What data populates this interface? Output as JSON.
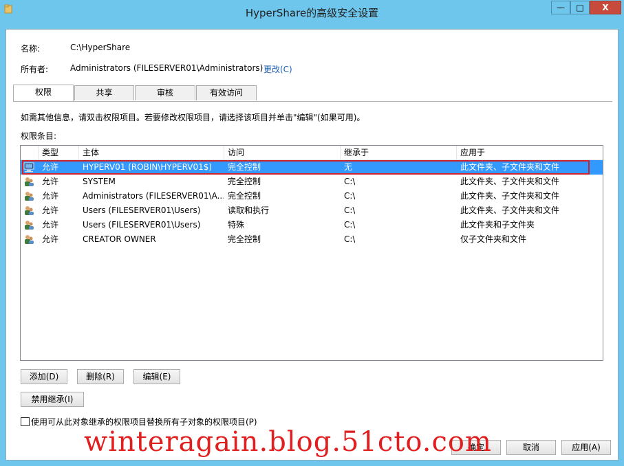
{
  "window": {
    "title": "HyperShare的高级安全设置",
    "min": "—",
    "max": "□",
    "close": "X"
  },
  "info": {
    "name_label": "名称:",
    "name_value": "C:\\HyperShare",
    "owner_label": "所有者:",
    "owner_value": "Administrators (FILESERVER01\\Administrators)",
    "owner_change": "更改(C)"
  },
  "tabs": [
    {
      "label": "权限",
      "active": true
    },
    {
      "label": "共享",
      "active": false
    },
    {
      "label": "审核",
      "active": false
    },
    {
      "label": "有效访问",
      "active": false
    }
  ],
  "help_text": "如需其他信息，请双击权限项目。若要修改权限项目，请选择该项目并单击\"编辑\"(如果可用)。",
  "entries_label": "权限条目:",
  "columns": [
    "类型",
    "主体",
    "访问",
    "继承于",
    "应用于"
  ],
  "rows": [
    {
      "type": "允许",
      "principal": "HYPERV01 (ROBIN\\HYPERV01$)",
      "access": "完全控制",
      "inherited": "无",
      "applies": "此文件夹、子文件夹和文件",
      "icon": "computer-icon",
      "selected": true
    },
    {
      "type": "允许",
      "principal": "SYSTEM",
      "access": "完全控制",
      "inherited": "C:\\",
      "applies": "此文件夹、子文件夹和文件",
      "icon": "users-icon",
      "selected": false
    },
    {
      "type": "允许",
      "principal": "Administrators (FILESERVER01\\A...",
      "access": "完全控制",
      "inherited": "C:\\",
      "applies": "此文件夹、子文件夹和文件",
      "icon": "users-icon",
      "selected": false
    },
    {
      "type": "允许",
      "principal": "Users (FILESERVER01\\Users)",
      "access": "读取和执行",
      "inherited": "C:\\",
      "applies": "此文件夹、子文件夹和文件",
      "icon": "users-icon",
      "selected": false
    },
    {
      "type": "允许",
      "principal": "Users (FILESERVER01\\Users)",
      "access": "特殊",
      "inherited": "C:\\",
      "applies": "此文件夹和子文件夹",
      "icon": "users-icon",
      "selected": false
    },
    {
      "type": "允许",
      "principal": "CREATOR OWNER",
      "access": "完全控制",
      "inherited": "C:\\",
      "applies": "仅子文件夹和文件",
      "icon": "users-icon",
      "selected": false
    }
  ],
  "buttons": {
    "add": "添加(D)",
    "remove": "删除(R)",
    "edit": "编辑(E)",
    "disable_inheritance": "禁用继承(I)",
    "ok": "确定",
    "cancel": "取消",
    "apply": "应用(A)"
  },
  "replace_checkbox_label": "使用可从此对象继承的权限项目替换所有子对象的权限项目(P)",
  "replace_checked": false,
  "watermark": "winteragain.blog.51cto.com",
  "colors": {
    "titlebar": "#6ec6ec",
    "selection": "#3399ff",
    "highlight_box": "#d0202a",
    "link": "#1a5fb4",
    "watermark": "#e02020"
  }
}
